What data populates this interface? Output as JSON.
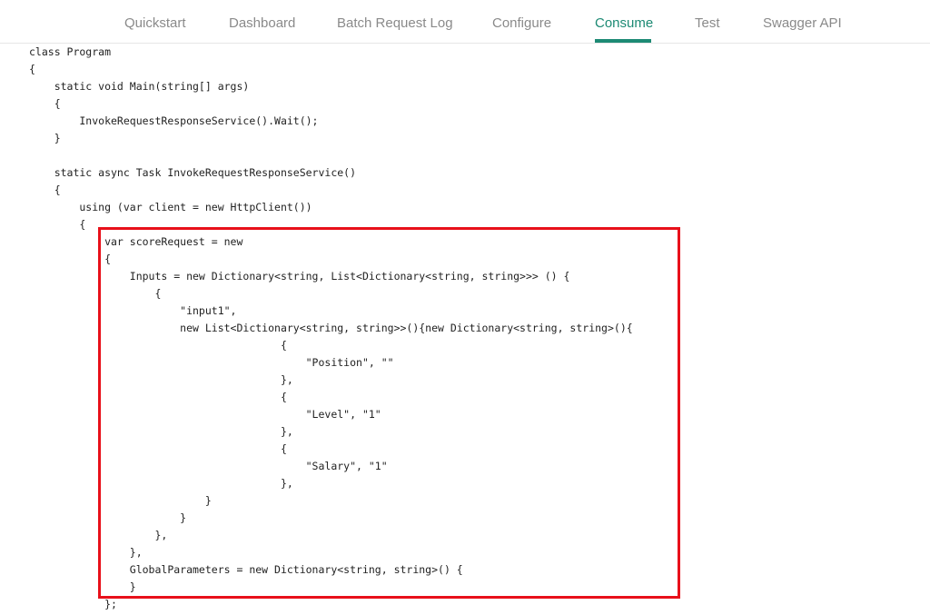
{
  "nav": {
    "tabs": [
      {
        "id": "quickstart",
        "label": "Quickstart"
      },
      {
        "id": "dashboard",
        "label": "Dashboard"
      },
      {
        "id": "batch-request-log",
        "label": "Batch Request Log"
      },
      {
        "id": "configure",
        "label": "Configure"
      },
      {
        "id": "consume",
        "label": "Consume"
      },
      {
        "id": "test",
        "label": "Test"
      },
      {
        "id": "swagger-api",
        "label": "Swagger API"
      }
    ],
    "active_tab": "Consume",
    "accent_color": "#1d8a74"
  },
  "code": {
    "lines": [
      "class Program",
      "{",
      "    static void Main(string[] args)",
      "    {",
      "        InvokeRequestResponseService().Wait();",
      "    }",
      "",
      "    static async Task InvokeRequestResponseService()",
      "    {",
      "        using (var client = new HttpClient())",
      "        {",
      "            var scoreRequest = new",
      "            {",
      "                Inputs = new Dictionary<string, List<Dictionary<string, string>>> () {",
      "                    {",
      "                        \"input1\",",
      "                        new List<Dictionary<string, string>>(){new Dictionary<string, string>(){",
      "                                        {",
      "                                            \"Position\", \"\"",
      "                                        },",
      "                                        {",
      "                                            \"Level\", \"1\"",
      "                                        },",
      "                                        {",
      "                                            \"Salary\", \"1\"",
      "                                        },",
      "                            }",
      "                        }",
      "                    },",
      "                },",
      "                GlobalParameters = new Dictionary<string, string>() {",
      "                }",
      "            };"
    ],
    "highlight_color": "#e8101a"
  }
}
